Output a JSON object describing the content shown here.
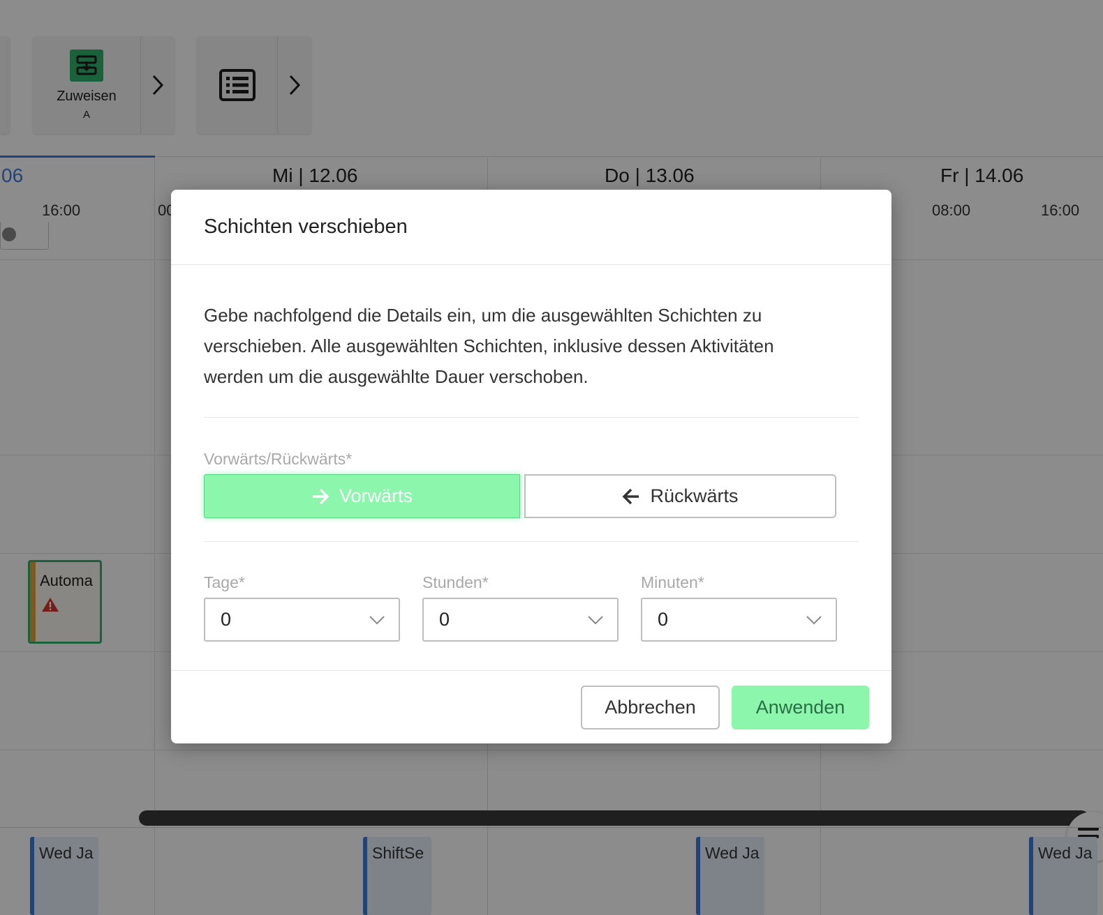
{
  "toolbar": {
    "assign_label": "Zuweisen",
    "assign_sublabel": "A"
  },
  "calendar": {
    "current_day_partial": "06",
    "days": [
      "Mi | 12.06",
      "Do | 13.06",
      "Fr | 14.06"
    ],
    "hours": {
      "left": "16:00",
      "mi_partial": "00",
      "fr_1": "08:00",
      "fr_2": "16:00"
    },
    "shift_card_label": "Automa",
    "bottom_shifts": [
      "Wed Ja",
      "ShiftSe",
      "Wed Ja",
      "Wed Ja"
    ]
  },
  "modal": {
    "title": "Schichten verschieben",
    "intro": "Gebe nachfolgend die Details ein, um die ausgewählten Schichten zu verschieben. Alle ausgewählten Schichten, inklusive dessen Aktivitäten werden um die ausgewählte Dauer verschoben.",
    "direction": {
      "label": "Vorwärts/Rückwärts*",
      "forward": "Vorwärts",
      "backward": "Rückwärts",
      "selected": "forward"
    },
    "fields": {
      "days": {
        "label": "Tage*",
        "value": "0"
      },
      "hours": {
        "label": "Stunden*",
        "value": "0"
      },
      "minutes": {
        "label": "Minuten*",
        "value": "0"
      }
    },
    "cancel_label": "Abbrechen",
    "apply_label": "Anwenden"
  },
  "colors": {
    "accent_green": "#8cf6ad",
    "brand_green": "#2fb36c",
    "current_day_blue": "#3b7ddd",
    "warning_red": "#d9342b"
  }
}
